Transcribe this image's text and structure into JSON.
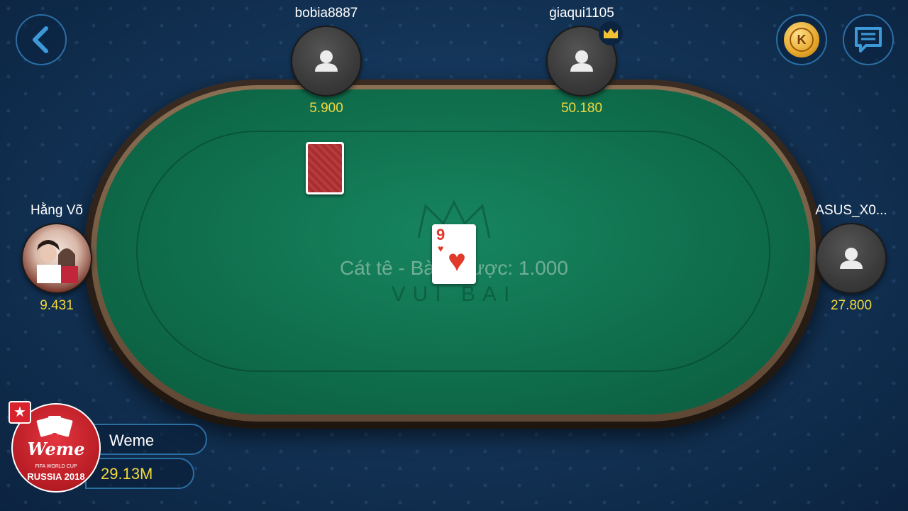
{
  "table": {
    "info": "Cát tê - Bàn:    Cược: 1.000",
    "watermark": "VUI BAI"
  },
  "players": [
    {
      "name": "bobia8887",
      "money": "5.900",
      "avatar": "default-user-icon"
    },
    {
      "name": "giaqui1105",
      "money": "50.180",
      "avatar": "default-user-icon",
      "badge": "crown-icon"
    },
    {
      "name": "Hằng Võ",
      "money": "9.431",
      "avatar": "photo"
    },
    {
      "name": "ASUS_X0...",
      "money": "27.800",
      "avatar": "default-user-icon"
    }
  ],
  "me": {
    "name": "Weme",
    "money": "29.13M",
    "logo_text": "Weme",
    "logo_sub": "FIFA WORLD CUP",
    "logo_bottom": "RUSSIA 2018"
  },
  "cards": {
    "played": {
      "rank": "9",
      "suit": "♥"
    },
    "back": "card-back"
  },
  "coin": {
    "label": "K"
  },
  "colors": {
    "felt": "#0f6e4c",
    "money": "#f3d83c",
    "accent": "#2b6ea3"
  }
}
